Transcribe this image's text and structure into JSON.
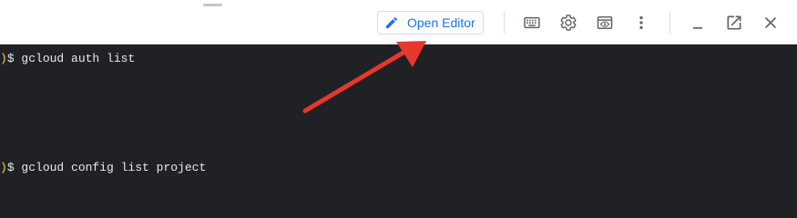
{
  "toolbar": {
    "open_editor_label": "Open Editor",
    "icons": {
      "keyboard": "keyboard-icon",
      "settings": "gear-icon",
      "web_preview": "web-preview-icon",
      "more": "more-vert-icon",
      "minimize": "minimize-icon",
      "open_new_window": "open-in-new-icon",
      "close": "close-icon",
      "edit": "pencil-icon"
    }
  },
  "terminal": {
    "lines": [
      {
        "paren": ")",
        "text": "$ gcloud auth list"
      },
      {
        "paren": ")",
        "text": "$ gcloud config list project"
      }
    ]
  },
  "colors": {
    "accent": "#1a73e8",
    "terminal_bg": "#202124",
    "terminal_text": "#e8eaed",
    "prompt_paren": "#f9ce5e",
    "annotation_arrow": "#e8372c"
  }
}
